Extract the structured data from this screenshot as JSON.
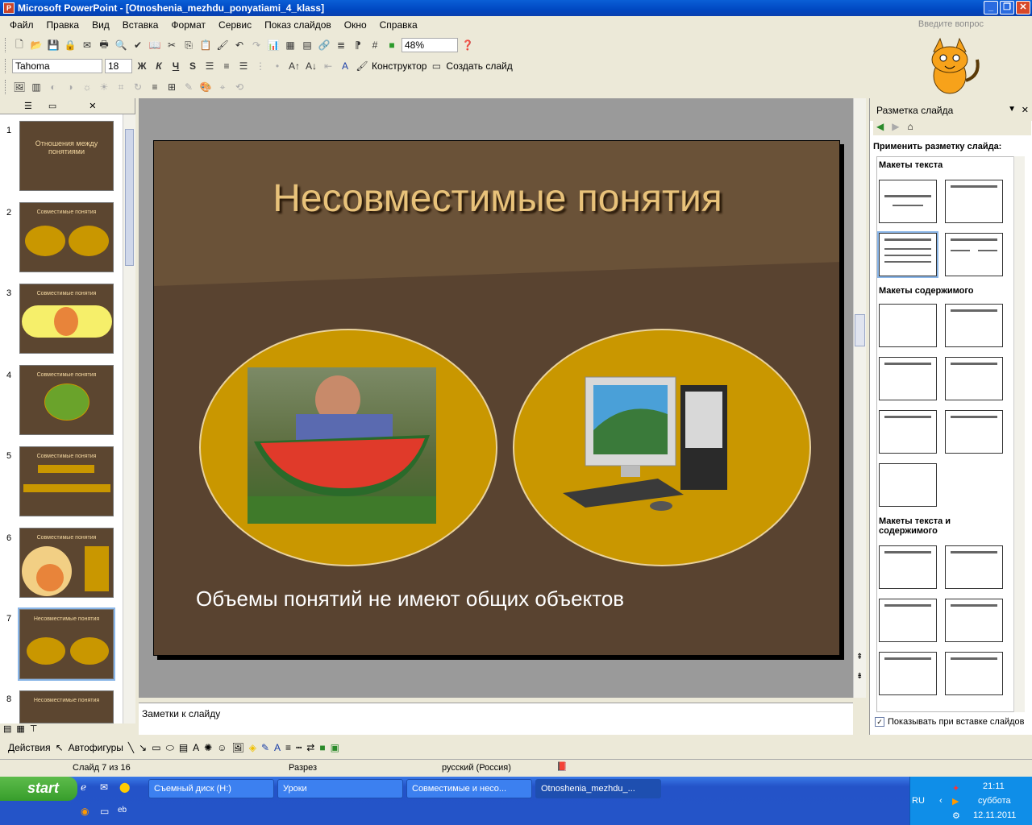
{
  "window": {
    "title": "Microsoft PowerPoint - [Otnoshenia_mezhdu_ponyatiami_4_klass]"
  },
  "menu": [
    "Файл",
    "Правка",
    "Вид",
    "Вставка",
    "Формат",
    "Сервис",
    "Показ слайдов",
    "Окно",
    "Справка"
  ],
  "help_placeholder": "Введите вопрос",
  "toolbar": {
    "zoom": "48%",
    "font": "Tahoma",
    "size": "18",
    "bold": "Ж",
    "italic": "К",
    "underline": "Ч",
    "shadow": "S",
    "designer": "Конструктор",
    "new_slide": "Создать слайд"
  },
  "thumbs": [
    {
      "n": "1",
      "title": "Отношения между понятиями"
    },
    {
      "n": "2",
      "title": "Совместимые понятия"
    },
    {
      "n": "3",
      "title": "Совместимые понятия"
    },
    {
      "n": "4",
      "title": "Совместимые понятия"
    },
    {
      "n": "5",
      "title": "Совместимые понятия"
    },
    {
      "n": "6",
      "title": "Совместимые понятия"
    },
    {
      "n": "7",
      "title": "Несовместимые понятия"
    },
    {
      "n": "8",
      "title": "Несовместимые понятия"
    }
  ],
  "slide": {
    "title": "Несовместимые понятия",
    "caption": "Объемы понятий не имеют общих объектов"
  },
  "notes": "Заметки к слайду",
  "rightpane": {
    "title": "Разметка слайда",
    "apply": "Применить разметку слайда:",
    "sec_text": "Макеты текста",
    "sec_content": "Макеты содержимого",
    "sec_text_content": "Макеты текста и содержимого",
    "show_on_insert": "Показывать при вставке слайдов"
  },
  "drawbar": {
    "actions": "Действия",
    "autoshapes": "Автофигуры"
  },
  "status": {
    "slide": "Слайд 7 из 16",
    "design": "Разрез",
    "lang": "русский (Россия)"
  },
  "taskbar": {
    "start": "start",
    "tasks": [
      "Съемный диск (H:)",
      "Уроки",
      "Совместимые и несо...",
      "Otnoshenia_mezhdu_..."
    ],
    "lang": "RU",
    "time": "21:11",
    "day": "суббота",
    "date": "12.11.2011"
  }
}
